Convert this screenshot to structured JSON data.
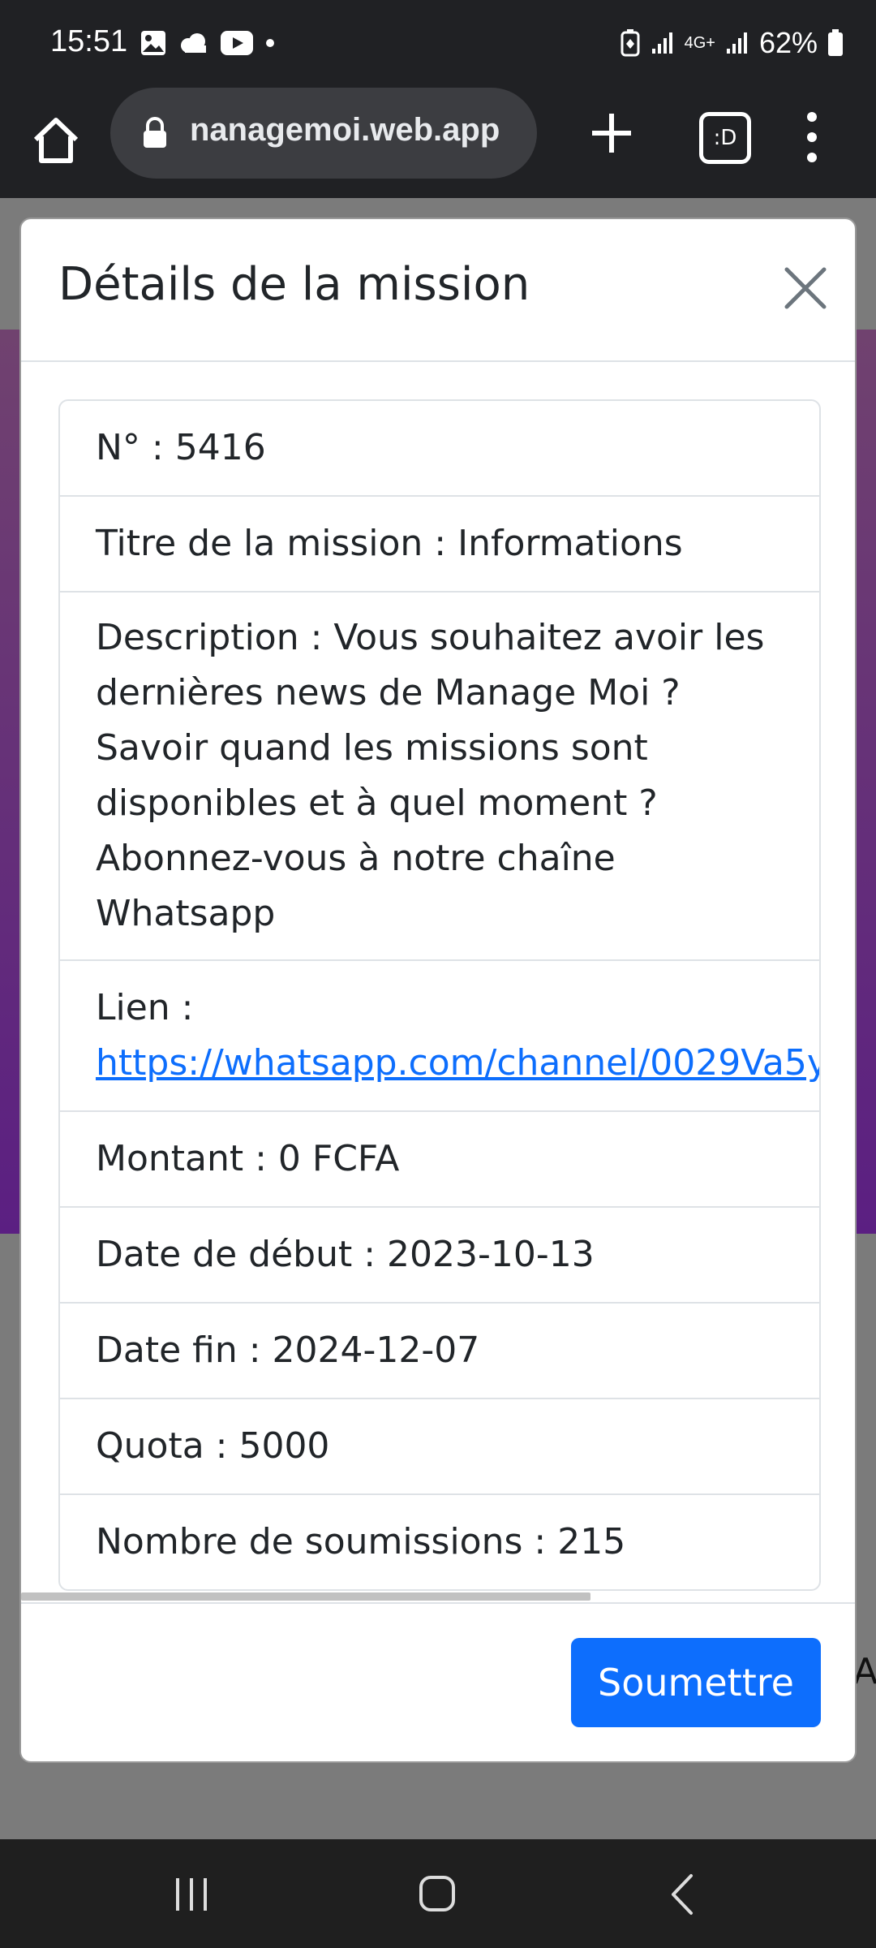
{
  "status_bar": {
    "time": "15:51",
    "network": "4G+",
    "battery": "62%",
    "icons": [
      "gallery-icon",
      "cloud-icon",
      "youtube-icon",
      "dot-icon",
      "battery-saver-icon",
      "signal-icon",
      "signal-icon",
      "battery-icon"
    ]
  },
  "browser": {
    "url": "nanagemoi.web.app",
    "tabs_label": ":D",
    "icons": [
      "home-icon",
      "lock-icon",
      "new-tab-icon",
      "tabs-icon",
      "more-menu-icon"
    ]
  },
  "modal": {
    "title": "Détails de la mission",
    "items": [
      {
        "text": "N° : 5416"
      },
      {
        "text": "Titre de la mission : Informations"
      },
      {
        "text": "Description : Vous souhaitez avoir les dernières news de Manage Moi ? Savoir quand les missions sont disponibles et à quel moment ? Abonnez-vous à notre chaîne Whatsapp"
      },
      {
        "label": "Lien :",
        "link": "https://whatsapp.com/channel/0029Va5y"
      },
      {
        "text": "Montant : 0 FCFA"
      },
      {
        "text": "Date de début : 2023-10-13"
      },
      {
        "text": "Date fin : 2024-12-07"
      },
      {
        "text": "Quota : 5000"
      },
      {
        "text": "Nombre de soumissions : 215"
      }
    ],
    "submit_label": "Soumettre"
  },
  "background_page": {
    "partial_text": "Ap"
  },
  "colors": {
    "primary": "#0d6efd",
    "link": "#0d6efd",
    "bar_bg": "#202124",
    "overlay": "#7b7b7b"
  }
}
